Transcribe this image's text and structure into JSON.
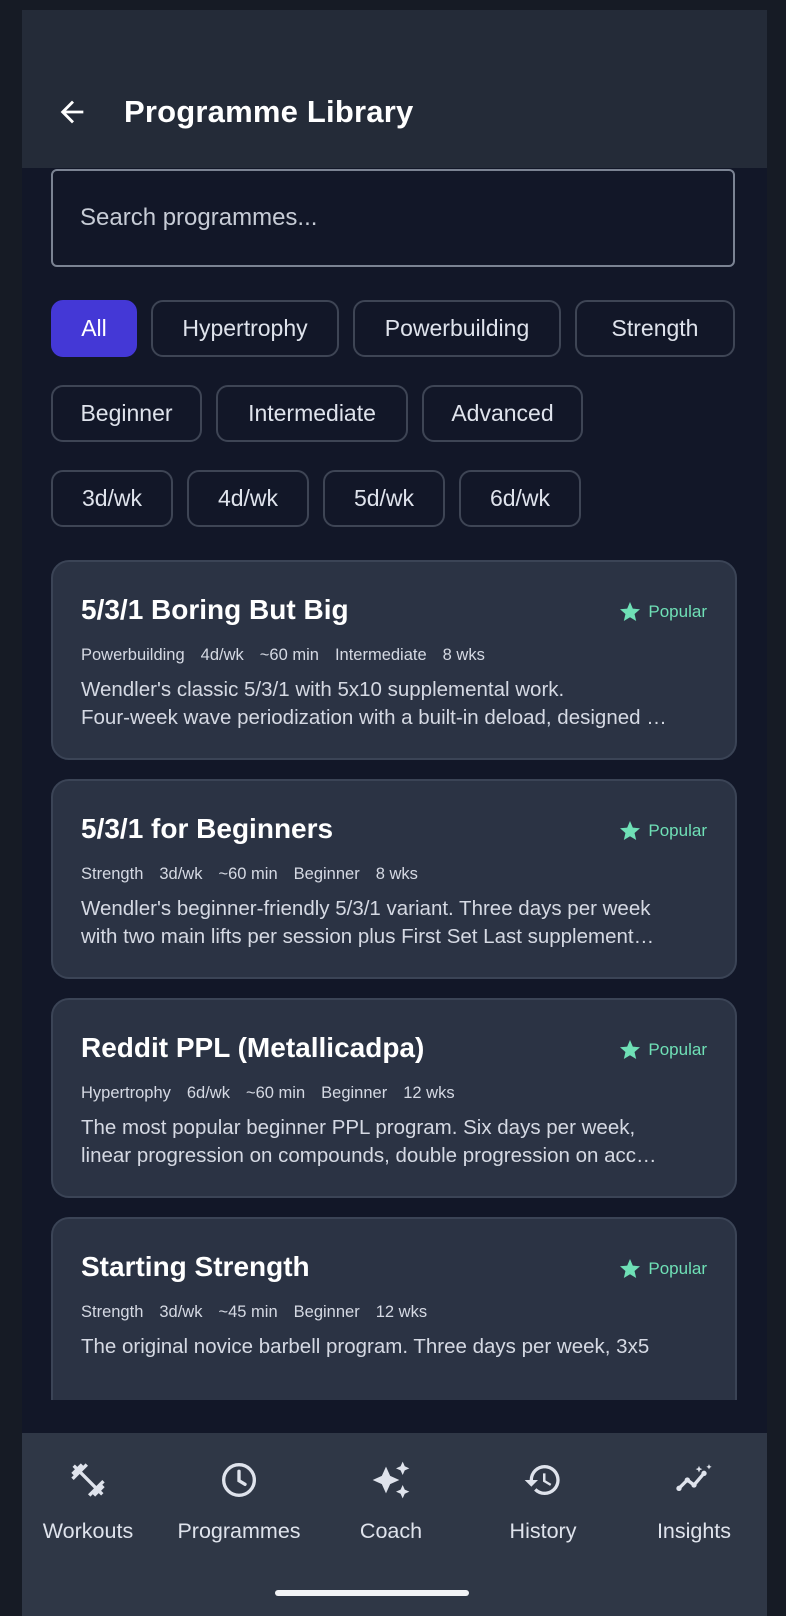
{
  "header": {
    "title": "Programme Library",
    "back_icon": "arrow-left-icon"
  },
  "search": {
    "placeholder": "Search programmes...",
    "value": ""
  },
  "filters": {
    "category": [
      {
        "label": "All",
        "selected": true
      },
      {
        "label": "Hypertrophy",
        "selected": false
      },
      {
        "label": "Powerbuilding",
        "selected": false
      },
      {
        "label": "Strength",
        "selected": false
      }
    ],
    "level": [
      {
        "label": "Beginner"
      },
      {
        "label": "Intermediate"
      },
      {
        "label": "Advanced"
      }
    ],
    "frequency": [
      {
        "label": "3d/wk"
      },
      {
        "label": "4d/wk"
      },
      {
        "label": "5d/wk"
      },
      {
        "label": "6d/wk"
      }
    ]
  },
  "programmes": [
    {
      "title": "5/3/1 Boring But Big",
      "badge": "Popular",
      "meta": [
        "Powerbuilding",
        "4d/wk",
        "~60 min",
        "Intermediate",
        "8 wks"
      ],
      "desc_line1": "Wendler's classic 5/3/1 with 5x10 supplemental work.",
      "desc_line2": "Four-week wave periodization with a built-in deload, designed …"
    },
    {
      "title": "5/3/1 for Beginners",
      "badge": "Popular",
      "meta": [
        "Strength",
        "3d/wk",
        "~60 min",
        "Beginner",
        "8 wks"
      ],
      "desc_line1": "Wendler's beginner-friendly 5/3/1 variant. Three days per week",
      "desc_line2": "with two main lifts per session plus First Set Last supplement…"
    },
    {
      "title": "Reddit PPL (Metallicadpa)",
      "badge": "Popular",
      "meta": [
        "Hypertrophy",
        "6d/wk",
        "~60 min",
        "Beginner",
        "12 wks"
      ],
      "desc_line1": "The most popular beginner PPL program. Six days per week,",
      "desc_line2": "linear progression on compounds, double progression on acc…"
    },
    {
      "title": "Starting Strength",
      "badge": "Popular",
      "meta": [
        "Strength",
        "3d/wk",
        "~45 min",
        "Beginner",
        "12 wks"
      ],
      "desc_line1": "The original novice barbell program. Three days per week, 3x5",
      "desc_line2": ""
    }
  ],
  "nav": [
    {
      "label": "Workouts",
      "icon": "dumbbell-icon"
    },
    {
      "label": "Programmes",
      "icon": "clock-icon"
    },
    {
      "label": "Coach",
      "icon": "sparkles-icon"
    },
    {
      "label": "History",
      "icon": "history-icon"
    },
    {
      "label": "Insights",
      "icon": "insights-icon"
    }
  ],
  "colors": {
    "background": "#121728",
    "appbar": "#242b38",
    "accent": "#4438d6",
    "card": "#2b3344",
    "popular": "#6fe0b6",
    "nav": "#2f3746"
  }
}
